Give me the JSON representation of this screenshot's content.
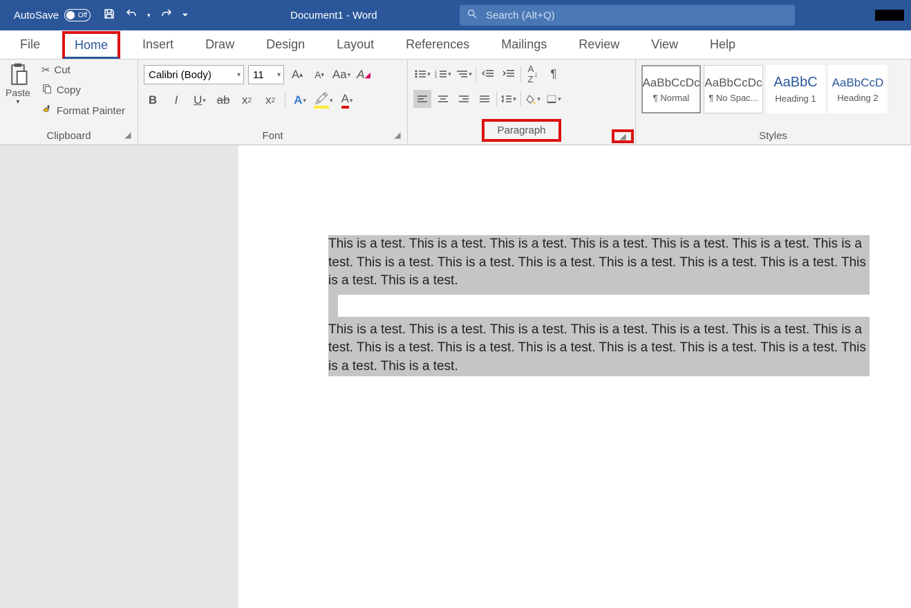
{
  "titlebar": {
    "autosave_label": "AutoSave",
    "autosave_state": "Off",
    "doc_title": "Document1 - Word",
    "search_placeholder": "Search (Alt+Q)"
  },
  "tabs": [
    "File",
    "Home",
    "Insert",
    "Draw",
    "Design",
    "Layout",
    "References",
    "Mailings",
    "Review",
    "View",
    "Help"
  ],
  "active_tab": "Home",
  "clipboard": {
    "paste": "Paste",
    "cut": "Cut",
    "copy": "Copy",
    "format_painter": "Format Painter",
    "group_label": "Clipboard"
  },
  "font": {
    "font_name": "Calibri (Body)",
    "font_size": "11",
    "group_label": "Font"
  },
  "paragraph": {
    "group_label": "Paragraph"
  },
  "styles": {
    "group_label": "Styles",
    "items": [
      {
        "preview": "AaBbCcDc",
        "name": "¶ Normal"
      },
      {
        "preview": "AaBbCcDc",
        "name": "¶ No Spac..."
      },
      {
        "preview": "AaBbC",
        "name": "Heading 1"
      },
      {
        "preview": "AaBbCcD",
        "name": "Heading 2"
      }
    ]
  },
  "document": {
    "para1": "This is a test. This is a test. This is a test. This is a test. This is a test. This is a test. This is a test. This is a test. This is a test. This is a test. This is a test. This is a test. This is a test. This is a test. This is a test.",
    "para2": "This is a test. This is a test. This is a test. This is a test. This is a test. This is a test. This is a test. This is a test. This is a test. This is a test. This is a test. This is a test. This is a test. This is a test. This is a test."
  },
  "highlights": [
    "home-tab",
    "paragraph-label",
    "paragraph-launcher"
  ]
}
